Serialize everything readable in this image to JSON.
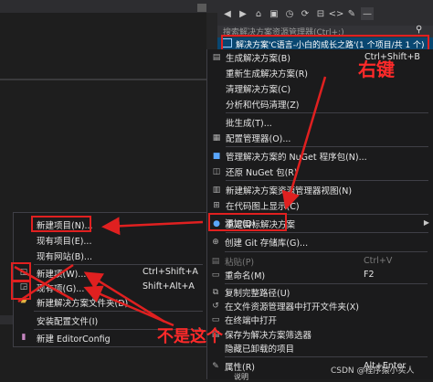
{
  "toolbar": {
    "icons": [
      "back-icon",
      "forward-icon",
      "home-icon",
      "solution-icon",
      "sync-icon",
      "refresh-icon",
      "collapse-icon",
      "code-icon",
      "properties-icon",
      "preview-icon"
    ]
  },
  "explorer": {
    "search_placeholder": "搜索解决方案资源管理器(Ctrl+;)",
    "selected_item": "解决方案'C语言-小白的成长之路'(1 个项目/共 1 个)"
  },
  "context_menu": {
    "items": [
      {
        "label": "生成解决方案(B)",
        "shortcut": "Ctrl+Shift+B"
      },
      {
        "label": "重新生成解决方案(R)",
        "shortcut": ""
      },
      {
        "label": "清理解决方案(C)",
        "shortcut": ""
      },
      {
        "label": "分析和代码清理(Z)",
        "shortcut": ""
      },
      {
        "label": "批生成(T)...",
        "shortcut": ""
      },
      {
        "label": "配置管理器(O)...",
        "shortcut": ""
      },
      {
        "label": "管理解决方案的 NuGet 程序包(N)...",
        "shortcut": ""
      },
      {
        "label": "还原 NuGet 包(R)",
        "shortcut": ""
      },
      {
        "label": "新建解决方案资源管理器视图(N)",
        "shortcut": ""
      },
      {
        "label": "在代码图上显示(C)",
        "shortcut": ""
      },
      {
        "label": "重定目标解决方案",
        "shortcut": ""
      },
      {
        "label": "添加(D)",
        "shortcut": ""
      },
      {
        "label": "创建 Git 存储库(G)...",
        "shortcut": ""
      },
      {
        "label": "粘贴(P)",
        "shortcut": "Ctrl+V"
      },
      {
        "label": "重命名(M)",
        "shortcut": "F2"
      },
      {
        "label": "复制完整路径(U)",
        "shortcut": ""
      },
      {
        "label": "在文件资源管理器中打开文件夹(X)",
        "shortcut": ""
      },
      {
        "label": "在终端中打开",
        "shortcut": ""
      },
      {
        "label": "保存为解决方案筛选器",
        "shortcut": ""
      },
      {
        "label": "隐藏已卸载的项目",
        "shortcut": ""
      },
      {
        "label": "属性(R)",
        "shortcut": "Alt+Enter"
      }
    ],
    "trailing_text": "说明"
  },
  "submenu": {
    "items": [
      {
        "label": "新建项目(N)...",
        "shortcut": ""
      },
      {
        "label": "现有项目(E)...",
        "shortcut": ""
      },
      {
        "label": "现有网站(B)...",
        "shortcut": ""
      },
      {
        "label": "新建项(W)...",
        "shortcut": "Ctrl+Shift+A"
      },
      {
        "label": "现有项(G)...",
        "shortcut": "Shift+Alt+A"
      },
      {
        "label": "新建解决方案文件夹(D)",
        "shortcut": ""
      },
      {
        "label": "安装配置文件(I)",
        "shortcut": ""
      },
      {
        "label": "新建 EditorConfig",
        "shortcut": ""
      }
    ]
  },
  "annotations": {
    "right_click": "右键",
    "not_this": "不是这个"
  },
  "watermark": "CSDN @程序猿小实人",
  "colors": {
    "accent_red": "#e02020",
    "selection": "#094771",
    "menu_bg": "#1b1b1c"
  }
}
